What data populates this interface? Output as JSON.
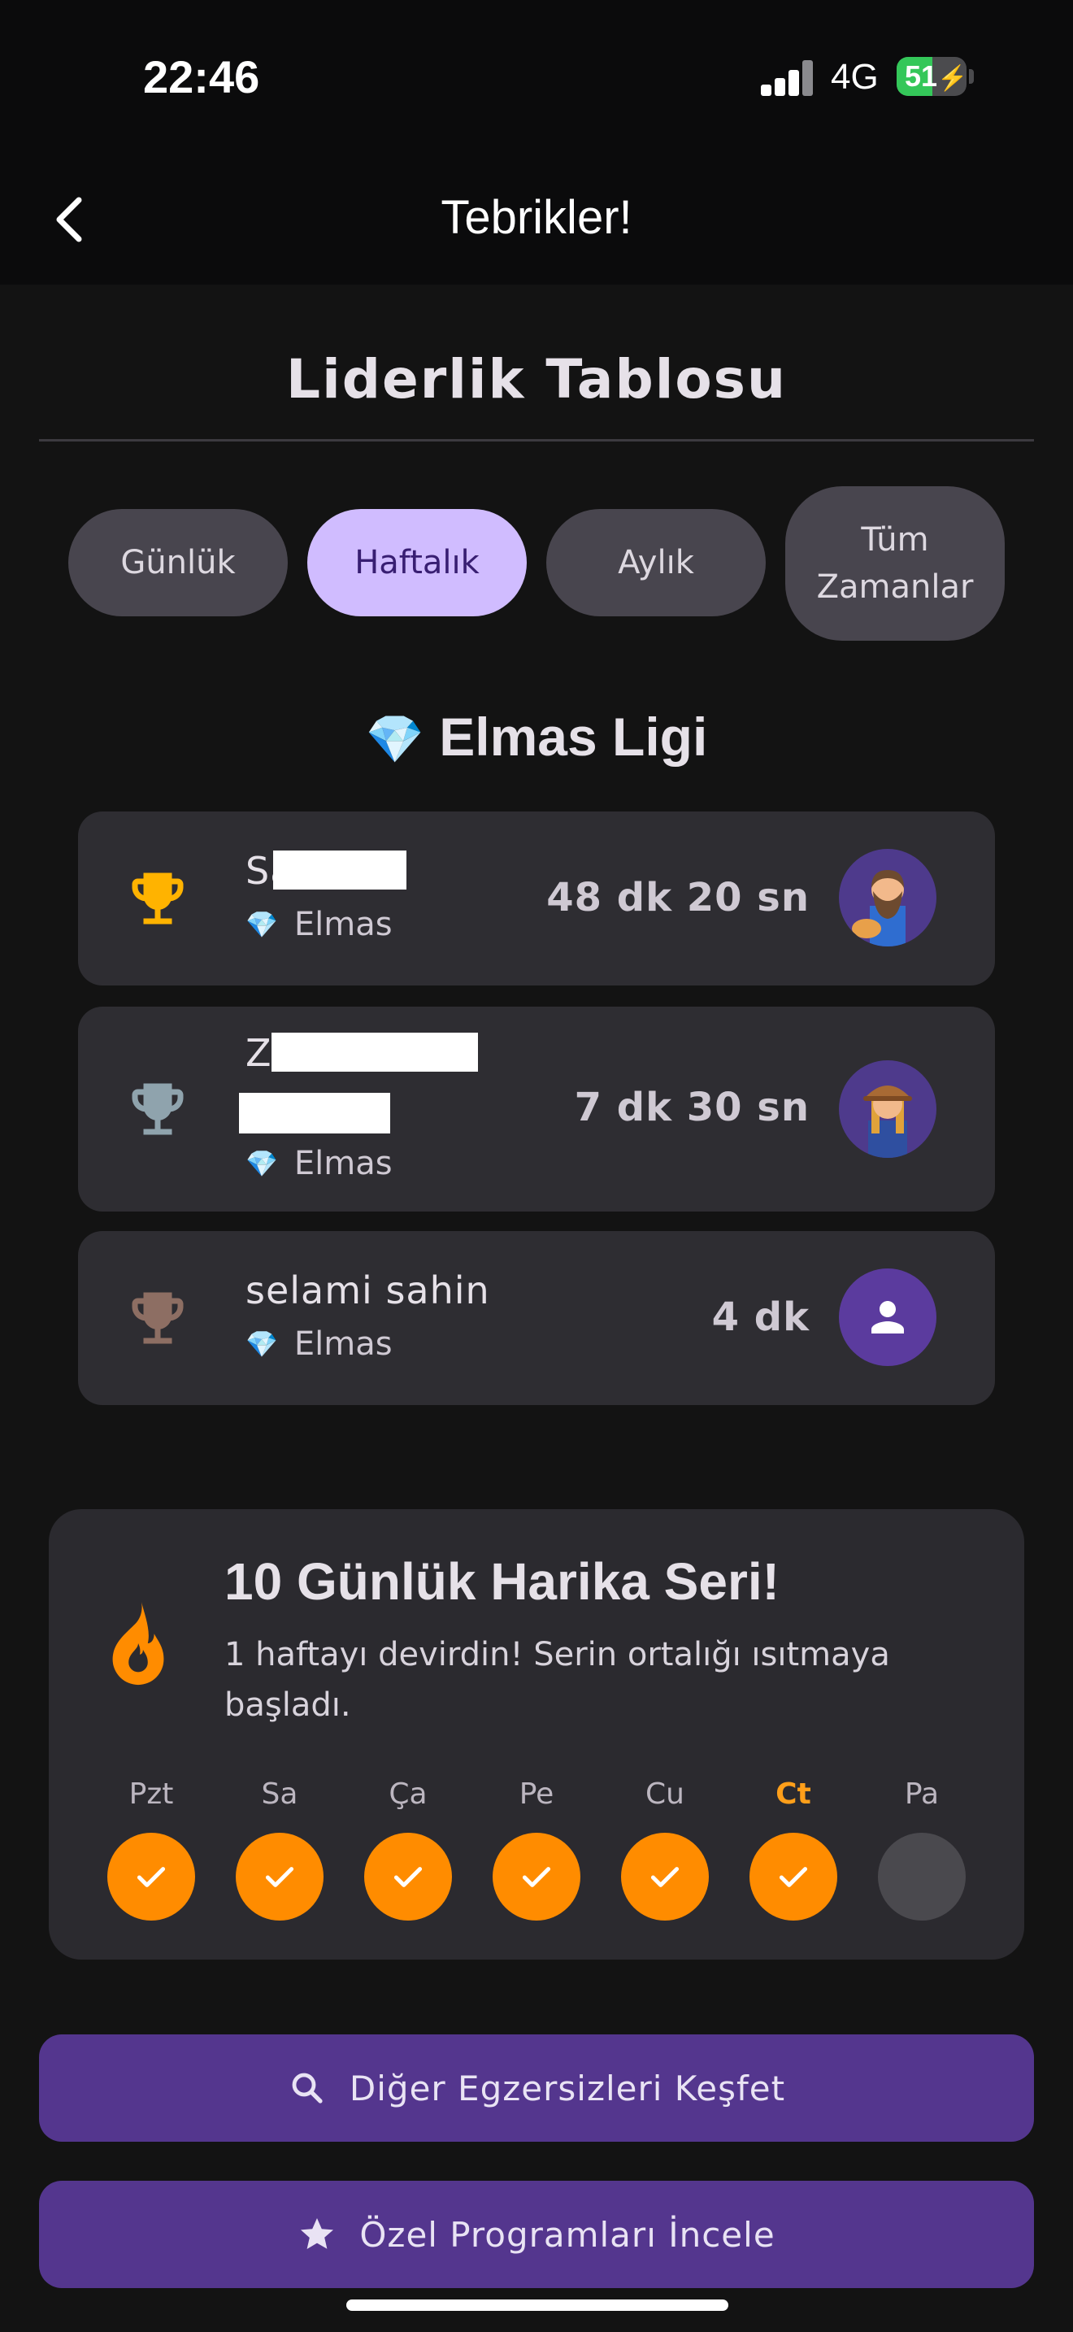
{
  "status_bar": {
    "time": "22:46",
    "network": "4G",
    "battery": "51",
    "battery_level": 0.51
  },
  "app_bar": {
    "title": "Tebrikler!",
    "back_icon": "chevron-left-icon"
  },
  "leaderboard": {
    "title": "Liderlik Tablosu",
    "tabs": [
      {
        "label": "Günlük",
        "active": false
      },
      {
        "label": "Haftalık",
        "active": true
      },
      {
        "label": "Aylık",
        "active": false
      },
      {
        "label": "Tüm\nZamanlar",
        "active": false
      }
    ],
    "league": {
      "icon": "💎",
      "name": "Elmas Ligi"
    },
    "entries": [
      {
        "rank_icon": "gold-trophy-icon",
        "name": "Sa",
        "league": "Elmas",
        "time": "48 dk 20 sn",
        "avatar": "bearded-man-avatar",
        "rank_color": "#ffb300"
      },
      {
        "rank_icon": "silver-trophy-icon",
        "name": "Z",
        "league": "Elmas",
        "time": "7 dk 30 sn",
        "avatar": "farmer-woman-avatar",
        "rank_color": "#8fa3ad"
      },
      {
        "rank_icon": "bronze-trophy-icon",
        "name": "selami sahin",
        "league": "Elmas",
        "time": "4 dk",
        "avatar": "default-person-avatar",
        "rank_color": "#8d6e63"
      }
    ]
  },
  "streak": {
    "title": "10 Günlük Harika Seri!",
    "description": "1 haftayı devirdin! Serin ortalığı ısıtmaya başladı.",
    "days": [
      {
        "label": "Pzt",
        "done": true,
        "today": false
      },
      {
        "label": "Sa",
        "done": true,
        "today": false
      },
      {
        "label": "Ça",
        "done": true,
        "today": false
      },
      {
        "label": "Pe",
        "done": true,
        "today": false
      },
      {
        "label": "Cu",
        "done": true,
        "today": false
      },
      {
        "label": "Ct",
        "done": true,
        "today": true
      },
      {
        "label": "Pa",
        "done": false,
        "today": false
      }
    ]
  },
  "actions": {
    "explore": {
      "label": "Diğer Egzersizleri Keşfet",
      "icon": "search-icon"
    },
    "programs": {
      "label": "Özel Programları İncele",
      "icon": "star-icon"
    }
  },
  "colors": {
    "accent": "#d0bcff",
    "button": "#54368e",
    "streak": "#ff8c00"
  }
}
